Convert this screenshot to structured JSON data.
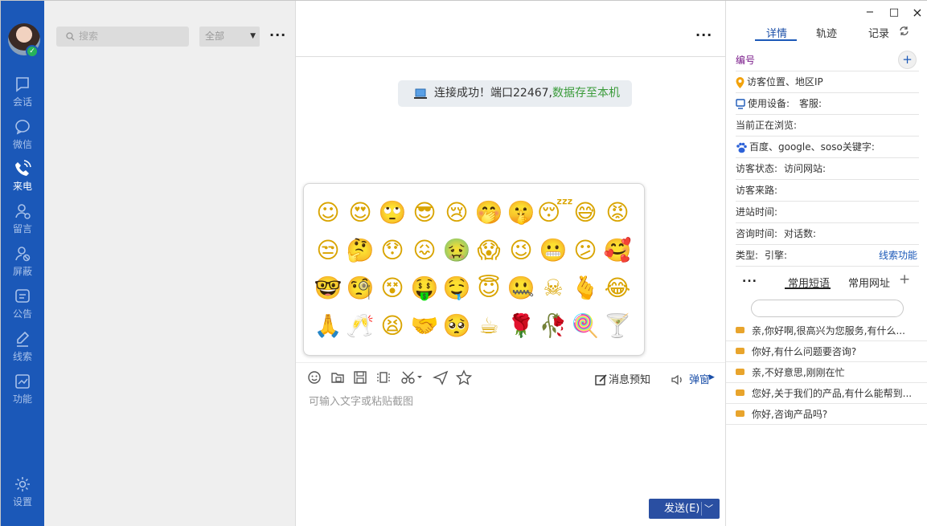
{
  "nav": {
    "items": [
      {
        "label": "会话",
        "icon": "chat-bubble-icon"
      },
      {
        "label": "微信",
        "icon": "wechat-icon"
      },
      {
        "label": "来电",
        "icon": "phone-icon"
      },
      {
        "label": "留言",
        "icon": "message-user-icon"
      },
      {
        "label": "屏蔽",
        "icon": "block-user-icon"
      },
      {
        "label": "公告",
        "icon": "notice-icon"
      },
      {
        "label": "线索",
        "icon": "pen-icon"
      },
      {
        "label": "功能",
        "icon": "chart-icon"
      }
    ],
    "settings_label": "设置",
    "active_index": 2
  },
  "list": {
    "search_placeholder": "搜索",
    "filter_value": "全部",
    "more": "..."
  },
  "chat": {
    "more": "...",
    "notice_text": "连接成功！端口22467,",
    "notice_green": "数据存至本机",
    "emojis": [
      "☺",
      "😍",
      "🙄",
      "😎",
      "😢",
      "🤭",
      "🤫",
      "😴",
      "😅",
      "😡",
      "😒",
      "🤔",
      "😯",
      "😖",
      "🤢",
      "😱",
      "😉",
      "😬",
      "😕",
      "🥰",
      "🤓",
      "🧐",
      "😵",
      "🤑",
      "🤤",
      "😇",
      "🤐",
      "☠",
      "🫰",
      "😂",
      "🙏",
      "🥂",
      "😫",
      "🤝",
      "🥺",
      "☕",
      "🌹",
      "🥀",
      "🍭",
      "🍸"
    ],
    "toolbar": {
      "message_preview": "消息预知",
      "popup": "弹窗"
    },
    "input_placeholder": "可输入文字或粘贴截图",
    "send_label": "发送(E)"
  },
  "side": {
    "window_buttons": {
      "minimize": "−",
      "maximize": "□",
      "close": "×"
    },
    "tabs": [
      "详情",
      "轨迹",
      "记录"
    ],
    "active_tab": 0,
    "rows": {
      "number": "编号",
      "location": "访客位置、地区IP",
      "device": "使用设备:",
      "agent": "客服:",
      "browsing": "当前正在浏览:",
      "keywords": "百度、google、soso关键字:",
      "status": "访客状态:",
      "visit_site": "访问网站:",
      "source": "访客来路:",
      "entry_time": "进站时间:",
      "consult_time": "咨询时间:",
      "conversation_count": "对话数:",
      "type": "类型:",
      "engine": "引擎:",
      "clue_link": "线索功能"
    },
    "phrase_tabs": [
      "常用短语",
      "常用网址"
    ],
    "phrases": [
      "亲,你好啊,很高兴为您服务,有什么...",
      "你好,有什么问题要咨询?",
      "亲,不好意思,刚刚在忙",
      "您好,关于我们的产品,有什么能帮到...",
      "你好,咨询产品吗?"
    ]
  }
}
